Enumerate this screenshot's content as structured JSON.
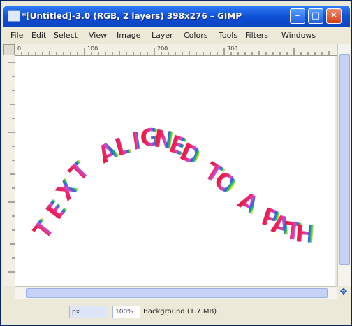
{
  "window": {
    "title": "*[Untitled]-3.0 (RGB, 2 layers) 398x276 – GIMP"
  },
  "menu": {
    "items": [
      "File",
      "Edit",
      "Select",
      "View",
      "Image",
      "Layer",
      "Colors",
      "Tools",
      "Filters",
      "Windows"
    ]
  },
  "ruler": {
    "top_labels": [
      "0",
      "100",
      "200",
      "300"
    ]
  },
  "canvas": {
    "letters": [
      "T",
      "E",
      "X",
      "T",
      " ",
      "A",
      "L",
      "I",
      "G",
      "N",
      "E",
      "D",
      " ",
      "T",
      "O",
      " ",
      "A",
      " ",
      "P",
      "A",
      "T",
      "H"
    ],
    "colors": {
      "red": "#e6112f",
      "magenta": "#ee2b7a",
      "violet": "#c64fd7",
      "blue": "#2b5fe6",
      "green": "#27c55a",
      "yellow": "#e8e630",
      "lavender": "#a7a7f2"
    }
  },
  "statusbar": {
    "unit": "px",
    "zoom": "100%",
    "text": "Background (1.7 MB)"
  }
}
